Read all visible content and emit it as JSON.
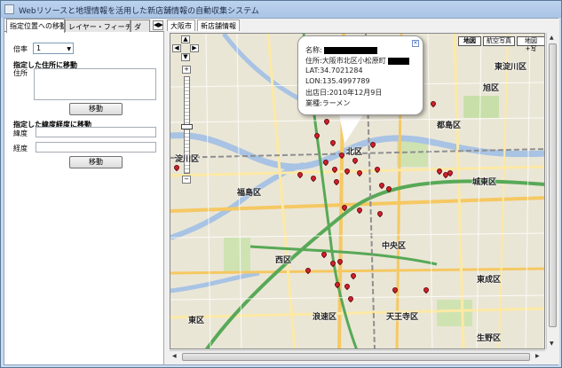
{
  "window": {
    "title": "Webリソースと地理情報を活用した新店舗情報の自動収集システム"
  },
  "left_panel": {
    "tabs": [
      "指定位置への移動",
      "レイヤー・フィーチャー管理",
      "ダ"
    ],
    "tab_scroll": "◀▶",
    "zoom_label": "倍率",
    "zoom_value": "1",
    "address_section": "指定した住所に移動",
    "address_label": "住所",
    "address_value": "",
    "move_button_1": "移動",
    "latlon_section": "指定した緯度経度に移動",
    "lat_label": "緯度",
    "lon_label": "経度",
    "lat_value": "",
    "lon_value": "",
    "move_button_2": "移動"
  },
  "map_panel": {
    "tabs": [
      "大阪市",
      "新店舗情報"
    ],
    "map_types": [
      "地図",
      "航空写真",
      "地図+写"
    ],
    "active_map_type": "地図",
    "balloon": {
      "name_label": "名称:",
      "address": "住所:大阪市北区小松原町",
      "lat": "LAT:34.7021284",
      "lon": "LON:135.4997789",
      "open_date": "出店日:2010年12月9日",
      "category": "業種:ラーメン"
    },
    "districts": [
      "北区",
      "福島区",
      "西区",
      "中央区",
      "城東区",
      "東成区",
      "天王寺区",
      "浪速区",
      "淀川区",
      "東淀川区",
      "旭区",
      "都島区",
      "生野区",
      "東区"
    ],
    "colors": {
      "map_bg": "#e8e3d2",
      "pin": "#d2202b"
    }
  }
}
